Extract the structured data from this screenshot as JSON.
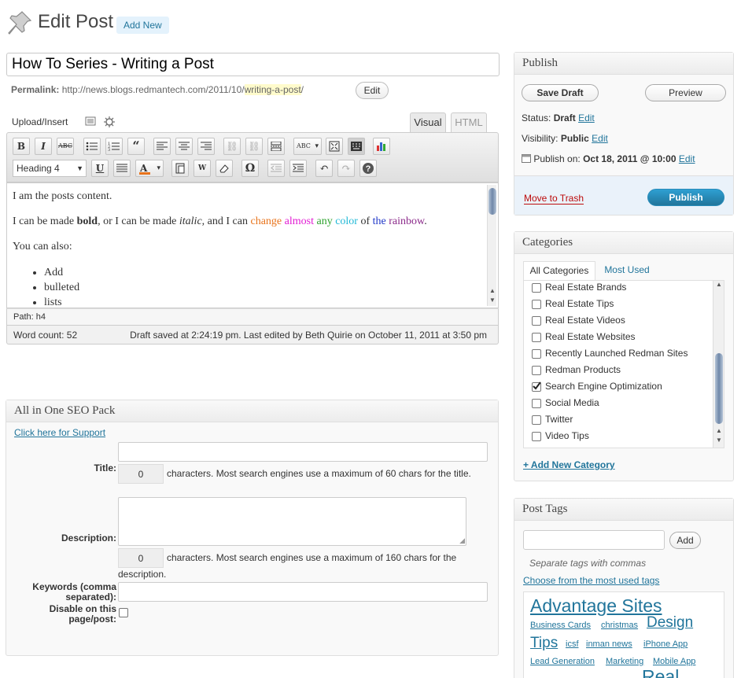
{
  "header": {
    "title": "Edit Post",
    "add_new": "Add New"
  },
  "post": {
    "title": "How To Series - Writing a Post",
    "permalink_label": "Permalink:",
    "permalink_base": "http://news.blogs.redmantech.com/2011/10/",
    "permalink_slug": "writing-a-post",
    "permalink_trailing": "/",
    "permalink_edit": "Edit"
  },
  "editor": {
    "upload_insert": "Upload/Insert",
    "tab_visual": "Visual",
    "tab_html": "HTML",
    "format_select": "Heading 4",
    "content": {
      "p1": "I am the posts content.",
      "p2_a": "I can be made ",
      "p2_bold": "bold",
      "p2_b": ", or I can be made ",
      "p2_italic": "italic",
      "p2_c": ", and I can ",
      "colored_words": [
        {
          "text": "change",
          "color": "#e8731b"
        },
        {
          "text": "almost",
          "color": "#e21bd3"
        },
        {
          "text": "any",
          "color": "#2ea32e"
        },
        {
          "text": "color",
          "color": "#1fb8d6"
        },
        {
          "text": "of",
          "color": "#333333"
        },
        {
          "text": "the",
          "color": "#1f37c8"
        },
        {
          "text": "rainbow",
          "color": "#8b2a8a"
        }
      ],
      "p2_end": ".",
      "p3": "You can also:",
      "list": [
        "Add",
        "bulleted",
        "lists"
      ]
    },
    "path": "Path: h4",
    "word_count": "Word count: 52",
    "draft_status": "Draft saved at 2:24:19 pm. Last edited by Beth Quirie on October 11, 2011 at 3:50 pm"
  },
  "seo": {
    "heading": "All in One SEO Pack",
    "support_link": "Click here for Support",
    "title_label": "Title:",
    "title_count": "0",
    "title_help": "characters. Most search engines use a maximum of 60 chars for the title.",
    "description_label": "Description:",
    "description_count": "0",
    "description_help": "characters. Most search engines use a maximum of 160 chars for the description.",
    "keywords_label": "Keywords (comma separated):",
    "disable_label": "Disable on this page/post:"
  },
  "publish": {
    "heading": "Publish",
    "save_draft": "Save Draft",
    "preview": "Preview",
    "status_label": "Status:",
    "status_value": "Draft",
    "visibility_label": "Visibility:",
    "visibility_value": "Public",
    "publish_on_label": "Publish on:",
    "publish_on_value": "Oct 18, 2011 @ 10:00",
    "edit": "Edit",
    "trash": "Move to Trash",
    "publish_button": "Publish"
  },
  "categories": {
    "heading": "Categories",
    "tab_all": "All Categories",
    "tab_most_used": "Most Used",
    "items": [
      {
        "label": "Real Estate Brands",
        "checked": false
      },
      {
        "label": "Real Estate Tips",
        "checked": false
      },
      {
        "label": "Real Estate Videos",
        "checked": false
      },
      {
        "label": "Real Estate Websites",
        "checked": false
      },
      {
        "label": "Recently Launched Redman Sites",
        "checked": false
      },
      {
        "label": "Redman Products",
        "checked": false
      },
      {
        "label": "Search Engine Optimization",
        "checked": true
      },
      {
        "label": "Social Media",
        "checked": false
      },
      {
        "label": "Twitter",
        "checked": false
      },
      {
        "label": "Video Tips",
        "checked": false
      }
    ],
    "add_new": "+ Add New Category"
  },
  "tags": {
    "heading": "Post Tags",
    "add_button": "Add",
    "hint": "Separate tags with commas",
    "choose_link": "Choose from the most used tags",
    "cloud": [
      "Advantage Sites",
      "Business Cards",
      "christmas",
      "Design",
      "Tips",
      "icsf",
      "inman news",
      "iPhone App",
      "Lead Generation",
      "Marketing",
      "Mobile App",
      "Real"
    ]
  },
  "colors": {
    "link": "#21759b",
    "publish": "#21759b",
    "trash": "#bc0b0b",
    "slug_highlight": "#fffbcc"
  }
}
